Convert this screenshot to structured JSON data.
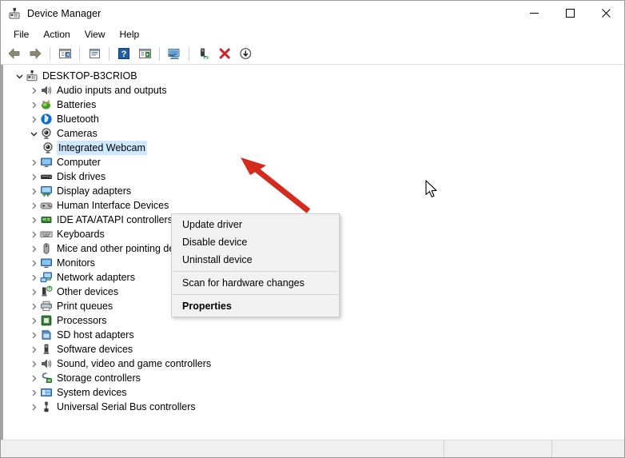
{
  "window": {
    "title": "Device Manager",
    "icon": "device-manager-icon",
    "controls": {
      "minimize": "minimize-icon",
      "maximize": "maximize-icon",
      "close": "close-icon"
    }
  },
  "menubar": {
    "items": [
      {
        "label": "File"
      },
      {
        "label": "Action"
      },
      {
        "label": "View"
      },
      {
        "label": "Help"
      }
    ]
  },
  "toolbar": {
    "buttons": [
      {
        "name": "back-icon",
        "title": "Back"
      },
      {
        "name": "forward-icon",
        "title": "Forward"
      },
      {
        "name": "separator-1",
        "title": ""
      },
      {
        "name": "show-hide-console-tree-icon",
        "title": "Show/Hide Console Tree"
      },
      {
        "name": "separator-2",
        "title": ""
      },
      {
        "name": "properties-icon",
        "title": "Properties"
      },
      {
        "name": "separator-3",
        "title": ""
      },
      {
        "name": "help-icon",
        "title": "Help"
      },
      {
        "name": "scan-for-hardware-changes-icon",
        "title": "Scan for hardware changes"
      },
      {
        "name": "separator-4",
        "title": ""
      },
      {
        "name": "update-driver-icon",
        "title": "Update driver"
      },
      {
        "name": "separator-5",
        "title": ""
      },
      {
        "name": "enable-device-icon",
        "title": "Enable device"
      },
      {
        "name": "uninstall-device-icon",
        "title": "Uninstall device"
      },
      {
        "name": "disable-device-icon",
        "title": "Disable device"
      }
    ]
  },
  "tree": {
    "nodes": [
      {
        "label": "DESKTOP-B3CRIOB",
        "indent": 0,
        "state": "expanded",
        "icon": "computer-root-icon",
        "selected": false
      },
      {
        "label": "Audio inputs and outputs",
        "indent": 1,
        "state": "collapsed",
        "icon": "speaker-icon",
        "selected": false
      },
      {
        "label": "Batteries",
        "indent": 1,
        "state": "collapsed",
        "icon": "battery-icon",
        "selected": false
      },
      {
        "label": "Bluetooth",
        "indent": 1,
        "state": "collapsed",
        "icon": "bluetooth-icon",
        "selected": false
      },
      {
        "label": "Cameras",
        "indent": 1,
        "state": "expanded",
        "icon": "camera-icon",
        "selected": false
      },
      {
        "label": "Integrated Webcam",
        "indent": 2,
        "state": "none",
        "icon": "camera-icon",
        "selected": true
      },
      {
        "label": "Computer",
        "indent": 1,
        "state": "collapsed",
        "icon": "monitor-icon",
        "selected": false
      },
      {
        "label": "Disk drives",
        "indent": 1,
        "state": "collapsed",
        "icon": "disk-drive-icon",
        "selected": false
      },
      {
        "label": "Display adapters",
        "indent": 1,
        "state": "collapsed",
        "icon": "display-adapter-icon",
        "selected": false
      },
      {
        "label": "Human Interface Devices",
        "indent": 1,
        "state": "collapsed",
        "icon": "gamepad-icon",
        "selected": false
      },
      {
        "label": "IDE ATA/ATAPI controllers",
        "indent": 1,
        "state": "collapsed",
        "icon": "ide-controller-icon",
        "selected": false
      },
      {
        "label": "Keyboards",
        "indent": 1,
        "state": "collapsed",
        "icon": "keyboard-icon",
        "selected": false
      },
      {
        "label": "Mice and other pointing devices",
        "indent": 1,
        "state": "collapsed",
        "icon": "mouse-icon",
        "selected": false
      },
      {
        "label": "Monitors",
        "indent": 1,
        "state": "collapsed",
        "icon": "monitor-icon",
        "selected": false
      },
      {
        "label": "Network adapters",
        "indent": 1,
        "state": "collapsed",
        "icon": "network-adapter-icon",
        "selected": false
      },
      {
        "label": "Other devices",
        "indent": 1,
        "state": "collapsed",
        "icon": "other-device-icon",
        "selected": false
      },
      {
        "label": "Print queues",
        "indent": 1,
        "state": "collapsed",
        "icon": "printer-icon",
        "selected": false
      },
      {
        "label": "Processors",
        "indent": 1,
        "state": "collapsed",
        "icon": "processor-icon",
        "selected": false
      },
      {
        "label": "SD host adapters",
        "indent": 1,
        "state": "collapsed",
        "icon": "sd-host-adapter-icon",
        "selected": false
      },
      {
        "label": "Software devices",
        "indent": 1,
        "state": "collapsed",
        "icon": "software-device-icon",
        "selected": false
      },
      {
        "label": "Sound, video and game controllers",
        "indent": 1,
        "state": "collapsed",
        "icon": "speaker-icon",
        "selected": false
      },
      {
        "label": "Storage controllers",
        "indent": 1,
        "state": "collapsed",
        "icon": "storage-controller-icon",
        "selected": false
      },
      {
        "label": "System devices",
        "indent": 1,
        "state": "collapsed",
        "icon": "system-device-icon",
        "selected": false
      },
      {
        "label": "Universal Serial Bus controllers",
        "indent": 1,
        "state": "collapsed",
        "icon": "usb-icon",
        "selected": false
      }
    ]
  },
  "context_menu": {
    "items": [
      {
        "label": "Update driver",
        "bold": false,
        "separator_after": false
      },
      {
        "label": "Disable device",
        "bold": false,
        "separator_after": false
      },
      {
        "label": "Uninstall device",
        "bold": false,
        "separator_after": true
      },
      {
        "label": "Scan for hardware changes",
        "bold": false,
        "separator_after": true
      },
      {
        "label": "Properties",
        "bold": true,
        "separator_after": false
      }
    ]
  },
  "annotation": {
    "type": "red-arrow",
    "color": "#d52b1e",
    "points_to": "Update driver"
  },
  "statusbar": {
    "segments": [
      "",
      "",
      ""
    ]
  },
  "colors": {
    "selection": "#cde8ff",
    "annotation_red": "#d52b1e",
    "menu_background": "#f2f2f2",
    "window_border": "#9c9c9c"
  }
}
